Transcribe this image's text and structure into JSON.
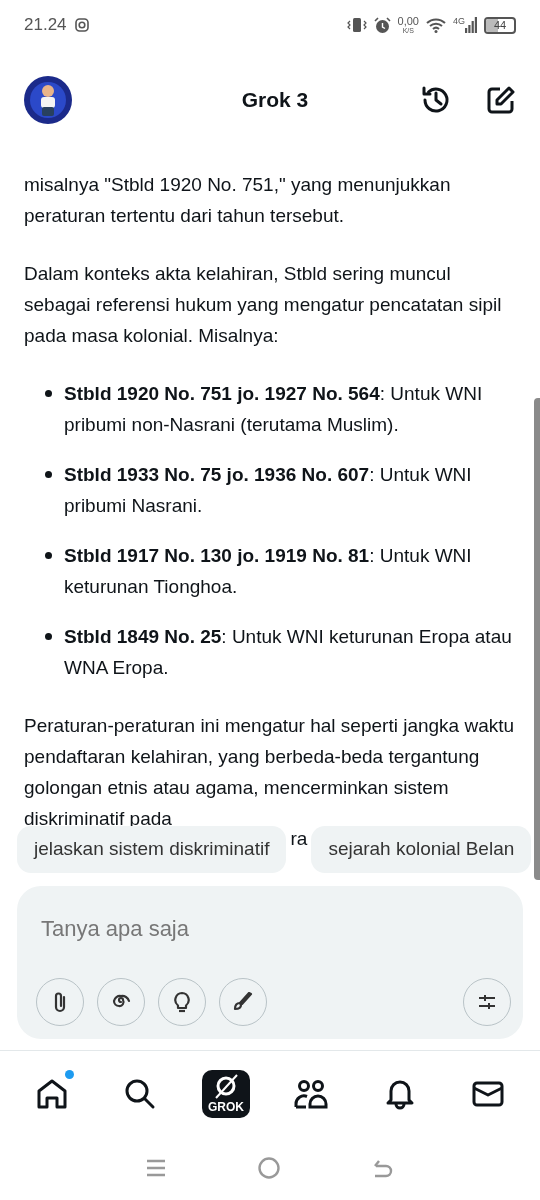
{
  "status_bar": {
    "time": "21.24",
    "network_speed": "0,00",
    "speed_unit": "K/S",
    "network_type": "4G",
    "battery": "44"
  },
  "header": {
    "title": "Grok 3"
  },
  "message": [
    {
      "kind": "paragraph",
      "lines": [
        "misalnya \"Stbld 1920 No. 751,\" yang menunjukkan peraturan tertentu dari tahun tersebut."
      ]
    },
    {
      "kind": "paragraph",
      "lines": [
        "Dalam konteks akta kelahiran, Stbld sering muncul sebagai referensi hukum yang mengatur pencatatan sipil pada masa kolonial. Misalnya:"
      ]
    },
    {
      "kind": "bullets",
      "items": [
        "**Stbld 1920 No. 751 jo. 1927 No. 564**: Untuk WNI pribumi non-Nasrani (terutama Muslim).",
        "**Stbld 1933 No. 75 jo. 1936 No. 607**: Untuk WNI pribumi Nasrani.",
        "**Stbld 1917 No. 130 jo. 1919 No. 81**: Untuk WNI keturunan Tionghoa.",
        "**Stbld 1849 No. 25**: Untuk WNI keturunan Eropa atau WNA Eropa."
      ]
    },
    {
      "kind": "paragraph",
      "lines": [
        "Peraturan-peraturan ini mengatur hal seperti jangka waktu pendaftaran kelahiran, yang berbeda-beda tergantung golongan etnis atau agama, mencerminkan sistem diskriminatif pada",
        "ra"
      ]
    }
  ],
  "suggestions": [
    "jelaskan sistem diskriminatif",
    "sejarah kolonial Belan"
  ],
  "composer": {
    "placeholder": "Tanya apa saja",
    "tools": [
      {
        "kind": "attach"
      },
      {
        "kind": "spiral"
      },
      {
        "kind": "bulb"
      },
      {
        "kind": "brush"
      }
    ]
  },
  "bottom_nav": [
    {
      "kind": "home",
      "badge": true
    },
    {
      "kind": "search",
      "badge": false
    },
    {
      "kind": "grok",
      "label": "GROK",
      "badge": false
    },
    {
      "kind": "people",
      "badge": false
    },
    {
      "kind": "bell",
      "badge": false
    },
    {
      "kind": "mail",
      "badge": false
    }
  ]
}
